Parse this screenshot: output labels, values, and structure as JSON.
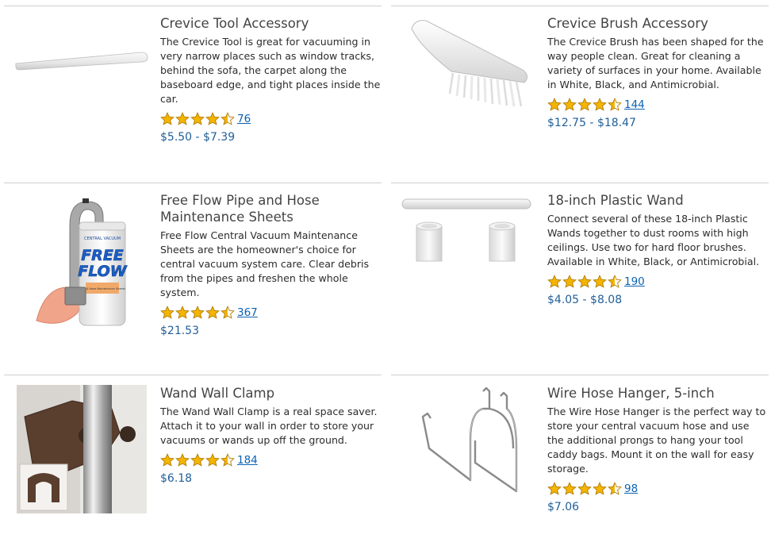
{
  "products": [
    {
      "title": "Crevice Tool Accessory",
      "description": "The Crevice Tool is great for vacuuming in very narrow places such as window tracks, behind the sofa, the carpet along the baseboard edge, and tight places inside the car.",
      "rating": 4.5,
      "reviews": "76",
      "price": "$5.50 - $7.39",
      "image_icon": "crevice-tool-image"
    },
    {
      "title": "Crevice Brush Accessory",
      "description": "The Crevice Brush has been shaped for the way people clean. Great for cleaning a variety of surfaces in your home. Available in White, Black, and Antimicrobial.",
      "rating": 4.5,
      "reviews": "144",
      "price": "$12.75 - $18.47",
      "image_icon": "crevice-brush-image"
    },
    {
      "title": "Free Flow Pipe and Hose Maintenance Sheets",
      "description": "Free Flow Central Vacuum Maintenance Sheets are the homeowner's choice for central vacuum system care. Clear debris from the pipes and freshen the whole system.",
      "rating": 4.5,
      "reviews": "367",
      "price": "$21.53",
      "image_icon": "free-flow-sheets-image",
      "image_text": {
        "small": "CENTRAL VACUUM",
        "brand1": "FREE",
        "brand2": "FLOW",
        "sub": "Pipe & Hose Maintenance Sheets"
      }
    },
    {
      "title": "18-inch Plastic Wand",
      "description": "Connect several of these 18-inch Plastic Wands together to dust rooms with high ceilings. Use two for hard floor brushes. Available in White, Black, or Antimicrobial.",
      "rating": 4.5,
      "reviews": "190",
      "price": "$4.05 - $8.08",
      "image_icon": "plastic-wand-image"
    },
    {
      "title": "Wand Wall Clamp",
      "description": "The Wand Wall Clamp is a real space saver. Attach it to your wall in order to store your vacuums or wands up off the ground.",
      "rating": 4.5,
      "reviews": "184",
      "price": "$6.18",
      "image_icon": "wall-clamp-image"
    },
    {
      "title": "Wire Hose Hanger, 5-inch",
      "description": "The Wire Hose Hanger is the perfect way to store your central vacuum hose and use the additional prongs to hang your tool caddy bags. Mount it on the wall for easy storage.",
      "rating": 4.5,
      "reviews": "98",
      "price": "$7.06",
      "image_icon": "wire-hanger-image"
    }
  ],
  "colors": {
    "star": "#f5b400",
    "star_outline": "#b07d00",
    "link": "#0b62b4",
    "price": "#1f5f99",
    "divider": "#cfcfcf"
  }
}
